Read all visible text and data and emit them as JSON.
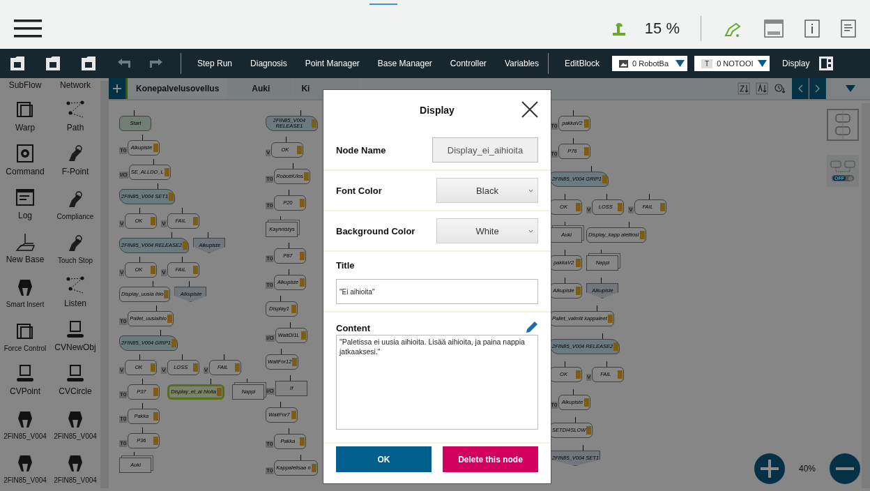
{
  "top_bar": {
    "speed": "15 %"
  },
  "toolbar": {
    "items": [
      "Step Run",
      "Diagnosis",
      "Point Manager",
      "Base Manager",
      "Controller",
      "Variables"
    ],
    "edit_block": "EditBlock",
    "base_select": {
      "value": "0 RobotBa"
    },
    "tool_select": {
      "badge": "T",
      "value": "0 NOTOOI"
    },
    "display": "Display"
  },
  "sidebar": {
    "items": [
      {
        "label": "SubFlow",
        "kind": "none"
      },
      {
        "label": "Network",
        "kind": "none"
      },
      {
        "label": "Warp",
        "kind": "warp"
      },
      {
        "label": "Path",
        "kind": "path"
      },
      {
        "label": "Command",
        "kind": "gear"
      },
      {
        "label": "F-Point",
        "kind": "robot"
      },
      {
        "label": "Log",
        "kind": "log"
      },
      {
        "label": "Compliance",
        "kind": "robot"
      },
      {
        "label": "New Base",
        "kind": "axes"
      },
      {
        "label": "Touch Stop",
        "kind": "robot"
      },
      {
        "label": "Smart Insert",
        "kind": "gripper"
      },
      {
        "label": "Listen",
        "kind": "path"
      },
      {
        "label": "Force Control",
        "kind": "warp"
      },
      {
        "label": "CVNewObj",
        "kind": "conveyor"
      },
      {
        "label": "CVPoint",
        "kind": "conveyor"
      },
      {
        "label": "CVCircle",
        "kind": "conveyor"
      },
      {
        "label": "2FIN85_V004",
        "kind": "gripper"
      },
      {
        "label": "2FIN85_V004",
        "kind": "gripper"
      },
      {
        "label": "2FIN85_V004",
        "kind": "gripper"
      },
      {
        "label": "2FIN85_V004",
        "kind": "gripper"
      }
    ]
  },
  "tabs": [
    {
      "label": "Konepalvelusovellus",
      "selected": true
    },
    {
      "label": "Auki",
      "selected": false
    },
    {
      "label": "Ki",
      "selected": false
    }
  ],
  "flow": {
    "columns": [
      {
        "rows": [
          {
            "nodes": [
              {
                "label": "Start",
                "kind": "start",
                "selected": false
              }
            ]
          },
          {
            "nodes": [
              {
                "label": "Alkupiste",
                "kind": "action",
                "tag": "T0",
                "selected": false
              }
            ]
          },
          {
            "nodes": [
              {
                "label": "SE_ALLDO_L",
                "kind": "action",
                "tag": "I/O",
                "selected": false
              }
            ]
          },
          {
            "nodes": [
              {
                "label": "2FIN85_V004 SET1",
                "kind": "gripper",
                "selected": false
              }
            ]
          },
          {
            "nodes": [
              {
                "label": "OK",
                "kind": "action",
                "tag": "V",
                "selected": false
              },
              {
                "label": "FAIL",
                "kind": "action",
                "tag": "V",
                "selected": false
              }
            ]
          },
          {
            "nodes": [
              {
                "label": "2FIN85_V004 RELEASE2",
                "kind": "gripper",
                "selected": false
              },
              {
                "label": "Alkupiste",
                "kind": "end",
                "selected": false
              }
            ]
          },
          {
            "nodes": [
              {
                "label": "OK",
                "kind": "action",
                "tag": "V",
                "selected": false
              },
              {
                "label": "FAIL",
                "kind": "action",
                "tag": "V",
                "selected": false
              }
            ]
          },
          {
            "nodes": [
              {
                "label": "Display_uusia ihio",
                "kind": "action",
                "selected": false
              },
              {
                "label": "Alkupiste",
                "kind": "end",
                "selected": false
              }
            ]
          },
          {
            "nodes": [
              {
                "label": "Pallet_uusiaihio",
                "kind": "action",
                "tag": "T0",
                "selected": false
              }
            ]
          },
          {
            "nodes": [
              {
                "label": "2FIN85_V004 GRIP1",
                "kind": "gripper",
                "selected": false
              }
            ]
          },
          {
            "nodes": [
              {
                "label": "OK",
                "kind": "action",
                "tag": "V",
                "selected": false
              },
              {
                "label": "LOSS",
                "kind": "action",
                "tag": "V",
                "selected": false
              },
              {
                "label": "FAIL",
                "kind": "action",
                "tag": "V",
                "selected": false
              }
            ]
          },
          {
            "nodes": [
              {
                "label": "P37",
                "kind": "action",
                "tag": "T0",
                "selected": false
              },
              {
                "label": "Display_ei_ai hioita",
                "kind": "action",
                "selected": true
              },
              {
                "label": "Nappi",
                "kind": "stack",
                "selected": false
              }
            ]
          },
          {
            "nodes": [
              {
                "label": "Pakka",
                "kind": "action",
                "tag": "T0",
                "selected": false
              }
            ]
          },
          {
            "nodes": [
              {
                "label": "P36",
                "kind": "action",
                "tag": "T0",
                "selected": false
              }
            ]
          },
          {
            "nodes": [
              {
                "label": "Auki",
                "kind": "stack",
                "selected": false
              }
            ]
          }
        ]
      },
      {
        "rows": [
          {
            "nodes": [
              {
                "label": "2FIN85_V004 RELEASE1",
                "kind": "gripper",
                "selected": false
              }
            ]
          },
          {
            "nodes": [
              {
                "label": "OK",
                "kind": "action",
                "tag": "V",
                "selected": false
              }
            ]
          },
          {
            "nodes": [
              {
                "label": "RobottiUlos",
                "kind": "action",
                "tag": "T0",
                "selected": false
              }
            ]
          },
          {
            "nodes": [
              {
                "label": "P20",
                "kind": "action",
                "tag": "T0",
                "selected": false
              }
            ]
          },
          {
            "nodes": [
              {
                "label": "Kaynnistys",
                "kind": "stack",
                "selected": false
              }
            ]
          },
          {
            "nodes": [
              {
                "label": "P87",
                "kind": "action",
                "tag": "T0",
                "selected": false
              }
            ]
          },
          {
            "nodes": [
              {
                "label": "Alkupiste",
                "kind": "action",
                "tag": "T0",
                "selected": false
              }
            ]
          },
          {
            "nodes": [
              {
                "label": "Display1",
                "kind": "action",
                "selected": false
              }
            ]
          },
          {
            "nodes": [
              {
                "label": "WaitDI1L",
                "kind": "action",
                "tag": "I/O",
                "selected": false
              }
            ]
          },
          {
            "nodes": [
              {
                "label": "WaitFor12",
                "kind": "action",
                "selected": false
              }
            ]
          },
          {
            "nodes": [
              {
                "label": "If",
                "kind": "decision",
                "tag": "I/O",
                "selected": false
              }
            ]
          },
          {
            "nodes": [
              {
                "label": "WaitFor7",
                "kind": "action",
                "selected": false
              }
            ]
          },
          {
            "nodes": [
              {
                "label": "Pakka",
                "kind": "action",
                "tag": "T0",
                "selected": false
              }
            ]
          },
          {
            "nodes": [
              {
                "label": "Kappalelisaa n",
                "kind": "action",
                "tag": "T0",
                "selected": false
              }
            ]
          }
        ]
      },
      {
        "rows": [
          {
            "nodes": [
              {
                "label": "pakkaV2",
                "kind": "action",
                "tag": "T0",
                "selected": false
              }
            ]
          },
          {
            "nodes": [
              {
                "label": "P76",
                "kind": "action",
                "tag": "T0",
                "selected": false
              }
            ]
          },
          {
            "nodes": [
              {
                "label": "2FIN85_V004 GRIP1",
                "kind": "gripper",
                "selected": false
              }
            ]
          },
          {
            "nodes": [
              {
                "label": "OK",
                "kind": "action",
                "selected": false
              },
              {
                "label": "LOSS",
                "kind": "action",
                "tag": "V",
                "selected": false
              },
              {
                "label": "FAIL",
                "kind": "action",
                "tag": "V",
                "selected": false
              }
            ]
          },
          {
            "nodes": [
              {
                "label": "Auki",
                "kind": "stack",
                "selected": false
              },
              {
                "label": "Display_kapp aleittosi",
                "kind": "action",
                "selected": false
              }
            ]
          },
          {
            "nodes": [
              {
                "label": "pakkaV2",
                "kind": "action",
                "selected": false
              },
              {
                "label": "Nappi",
                "kind": "stack",
                "selected": false
              }
            ]
          },
          {
            "nodes": [
              {
                "label": "Alkupiste",
                "kind": "action",
                "selected": false
              },
              {
                "label": "Alkupiste",
                "kind": "end",
                "selected": false
              }
            ]
          },
          {
            "nodes": [
              {
                "label": "Pallet_valmiit kappaleet",
                "kind": "action",
                "selected": false
              }
            ]
          },
          {
            "nodes": [
              {
                "label": "2FIN85_V004 RELEASE2",
                "kind": "gripper",
                "selected": false
              }
            ]
          },
          {
            "nodes": [
              {
                "label": "OK",
                "kind": "action",
                "selected": false
              },
              {
                "label": "FAIL",
                "kind": "action",
                "tag": "V",
                "selected": false
              }
            ]
          },
          {
            "nodes": [
              {
                "label": "Alkupiste",
                "kind": "action",
                "tag": "T0",
                "selected": false
              }
            ]
          },
          {
            "nodes": [
              {
                "label": "SETDI4SLOW",
                "kind": "action",
                "selected": false
              }
            ]
          },
          {
            "nodes": [
              {
                "label": "2FIN85_V004 SET1",
                "kind": "end",
                "selected": false
              }
            ]
          }
        ]
      }
    ]
  },
  "toggle": {
    "label": "OFF",
    "on": false
  },
  "zoom": "40%",
  "dialog": {
    "title": "Display",
    "node_name": {
      "label": "Node Name",
      "value": "Display_ei_aihioita"
    },
    "font_color": {
      "label": "Font Color",
      "value": "Black"
    },
    "background_color": {
      "label": "Background Color",
      "value": "White"
    },
    "title_field": {
      "label": "Title",
      "value": "\"Ei aihioita\""
    },
    "content": {
      "label": "Content",
      "value": "\"Paletissa ei uusia aihioita. Lisää aihioita, ja paina nappia jatkaaksesi.\""
    },
    "buttons": [
      {
        "label": "OK",
        "kind": "primary"
      },
      {
        "label": "Delete this node",
        "kind": "danger"
      }
    ]
  }
}
